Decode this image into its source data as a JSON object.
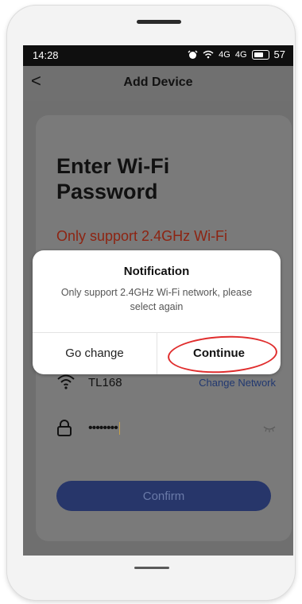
{
  "status": {
    "time": "14:28",
    "battery": "57",
    "icons": [
      "alarm-icon",
      "wifi-icon",
      "signal-icon",
      "signal-icon",
      "battery-icon"
    ],
    "signal_labels": [
      "4G",
      "4G"
    ]
  },
  "appbar": {
    "back_glyph": "<",
    "title": "Add Device"
  },
  "card": {
    "heading": "Enter Wi-Fi Password",
    "warning": "Only support 2.4GHz Wi-Fi",
    "wifi_name": "TL168",
    "change_network": "Change Network",
    "password_mask": "••••••••",
    "confirm": "Confirm"
  },
  "dialog": {
    "title": "Notification",
    "message": "Only support 2.4GHz Wi-Fi network, please select again",
    "go_change": "Go change",
    "continue": "Continue"
  },
  "colors": {
    "overlay": "#6f6f6f",
    "confirm_button": "#27366a",
    "warning_text": "#8d2412",
    "highlight_circle": "#e02d2d"
  }
}
